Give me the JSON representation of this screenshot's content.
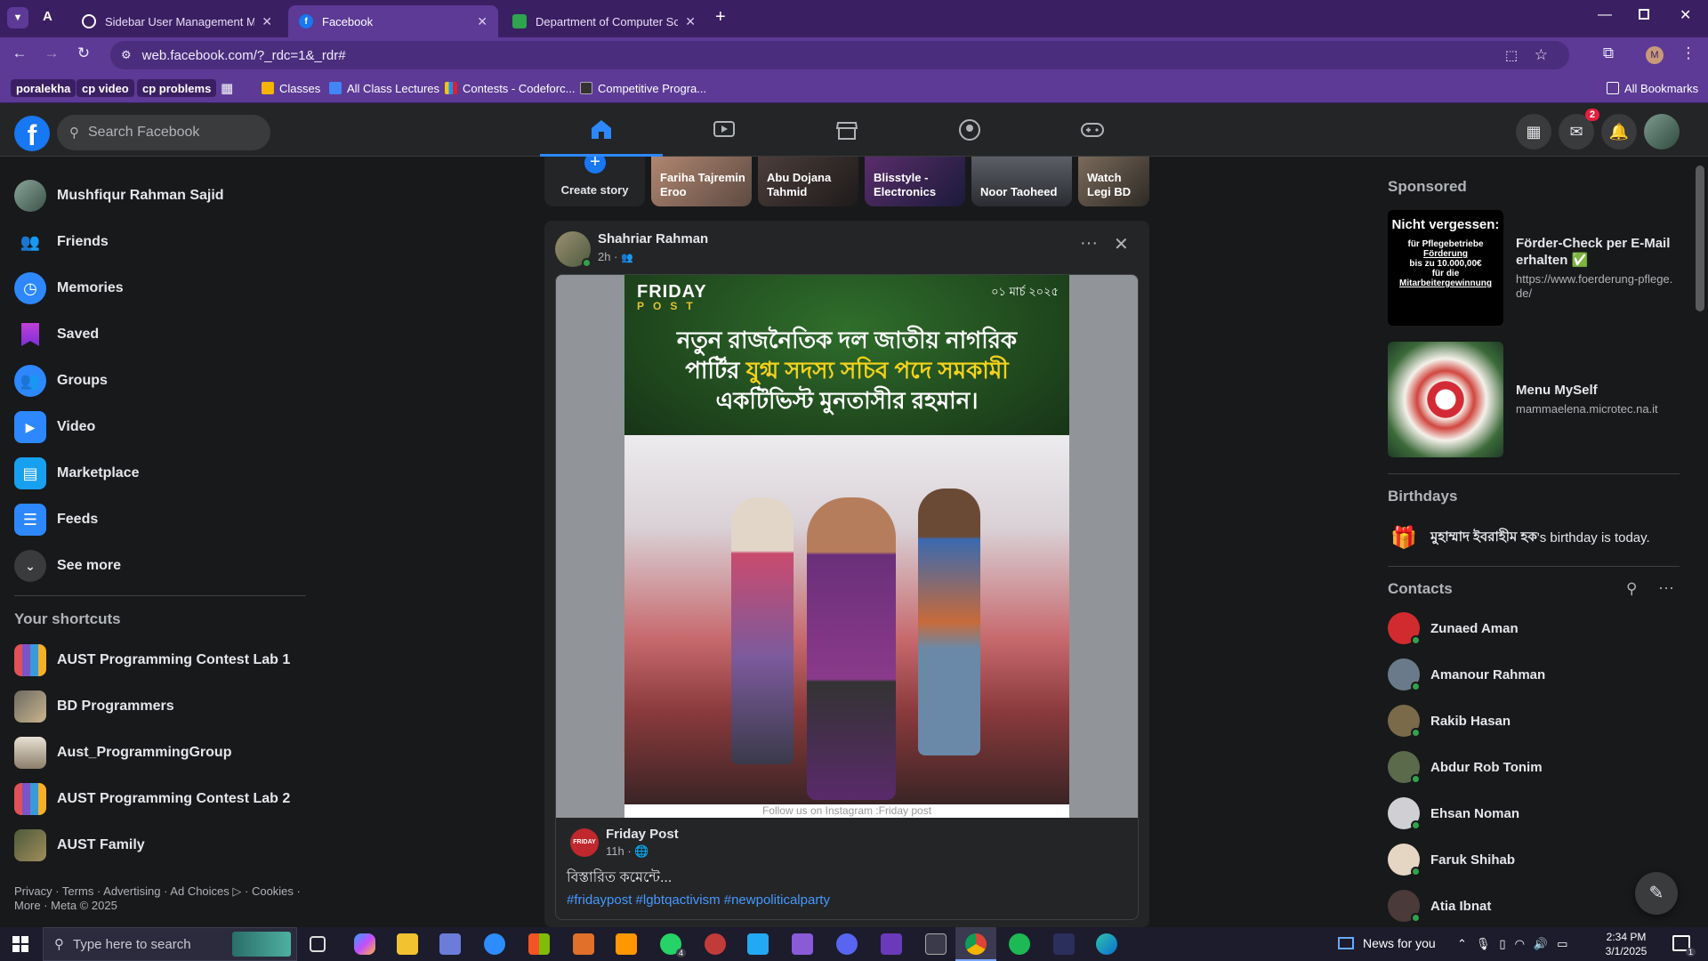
{
  "browser": {
    "tabs": [
      {
        "title": "Sidebar User Management Me",
        "active": false
      },
      {
        "title": "Facebook",
        "active": true
      },
      {
        "title": "Department of Computer Scien",
        "active": false
      }
    ],
    "url": "web.facebook.com/?_rdc=1&_rdr#",
    "profile_initial": "M",
    "bookmarks": [
      "poralekha",
      "cp video",
      "cp problems",
      "Classes",
      "All Class Lectures",
      "Contests - Codeforc...",
      "Competitive Progra..."
    ],
    "all_bookmarks": "All Bookmarks"
  },
  "header": {
    "search_placeholder": "Search Facebook",
    "messenger_badge": "2"
  },
  "left_nav": {
    "profile_name": "Mushfiqur Rahman Sajid",
    "items": [
      "Friends",
      "Memories",
      "Saved",
      "Groups",
      "Video",
      "Marketplace",
      "Feeds",
      "See more"
    ],
    "shortcuts_title": "Your shortcuts",
    "shortcuts": [
      "AUST Programming Contest Lab 1",
      "BD Programmers",
      "Aust_ProgrammingGroup",
      "AUST Programming Contest Lab 2",
      "AUST Family"
    ],
    "footer": "Privacy · Terms · Advertising · Ad Choices ▷ · Cookies · More · Meta © 2025"
  },
  "stories": {
    "create_label": "Create story",
    "items": [
      "Fariha Tajremin Eroo",
      "Abu Dojana Tahmid",
      "Blisstyle - Electronics",
      "Noor Taoheed",
      "Watch Legi BD"
    ]
  },
  "post": {
    "author": "Shahriar Rahman",
    "time": "2h ·",
    "image": {
      "brand_top": "FRIDAY",
      "brand_bottom": "POST",
      "date": "০১ মার্চ ২০২৫",
      "headline_line1": "নতুন রাজনৈতিক দল জাতীয় নাগরিক",
      "headline_line2_white": "পার্টির ",
      "headline_line2_yellow": "যুগ্ম সদস্য সচিব পদে সমকামী",
      "headline_line3": "একটিভিস্ট মুনতাসীর রহমান।",
      "caption": "Follow us on Instagram :Friday post"
    },
    "shared_author": "Friday Post",
    "shared_time": "11h ·",
    "text": "বিস্তারিত কমেন্টে...",
    "hashtags": "#fridaypost #lgbtqactivism #newpoliticalparty"
  },
  "right_col": {
    "sponsored_title": "Sponsored",
    "ads": [
      {
        "title": "Förder-Check per E-Mail erhalten ✅",
        "url": "https://www.foerderung-pflege.de/",
        "thumb_heading": "Nicht vergessen:",
        "thumb_l1": "für Pflegebetriebe",
        "thumb_l2": "Förderung",
        "thumb_l3": "bis zu 10.000,00€",
        "thumb_l4": "für die",
        "thumb_l5": "Mitarbeitergewinnung"
      },
      {
        "title": "Menu MySelf",
        "url": "mammaelena.microtec.na.it"
      }
    ],
    "birthdays_title": "Birthdays",
    "birthday_name": "মুহাম্মাদ ইবরাহীম হক",
    "birthday_text": "'s birthday is today.",
    "contacts_title": "Contacts",
    "contacts": [
      "Zunaed Aman",
      "Amanour Rahman",
      "Rakib Hasan",
      "Abdur Rob Tonim",
      "Ehsan Noman",
      "Faruk Shihab",
      "Atia Ibnat"
    ]
  },
  "taskbar": {
    "search_placeholder": "Type here to search",
    "news": "News for you",
    "time": "2:34 PM",
    "date": "3/1/2025",
    "whatsapp_badge": "4",
    "notif_count": "1"
  }
}
